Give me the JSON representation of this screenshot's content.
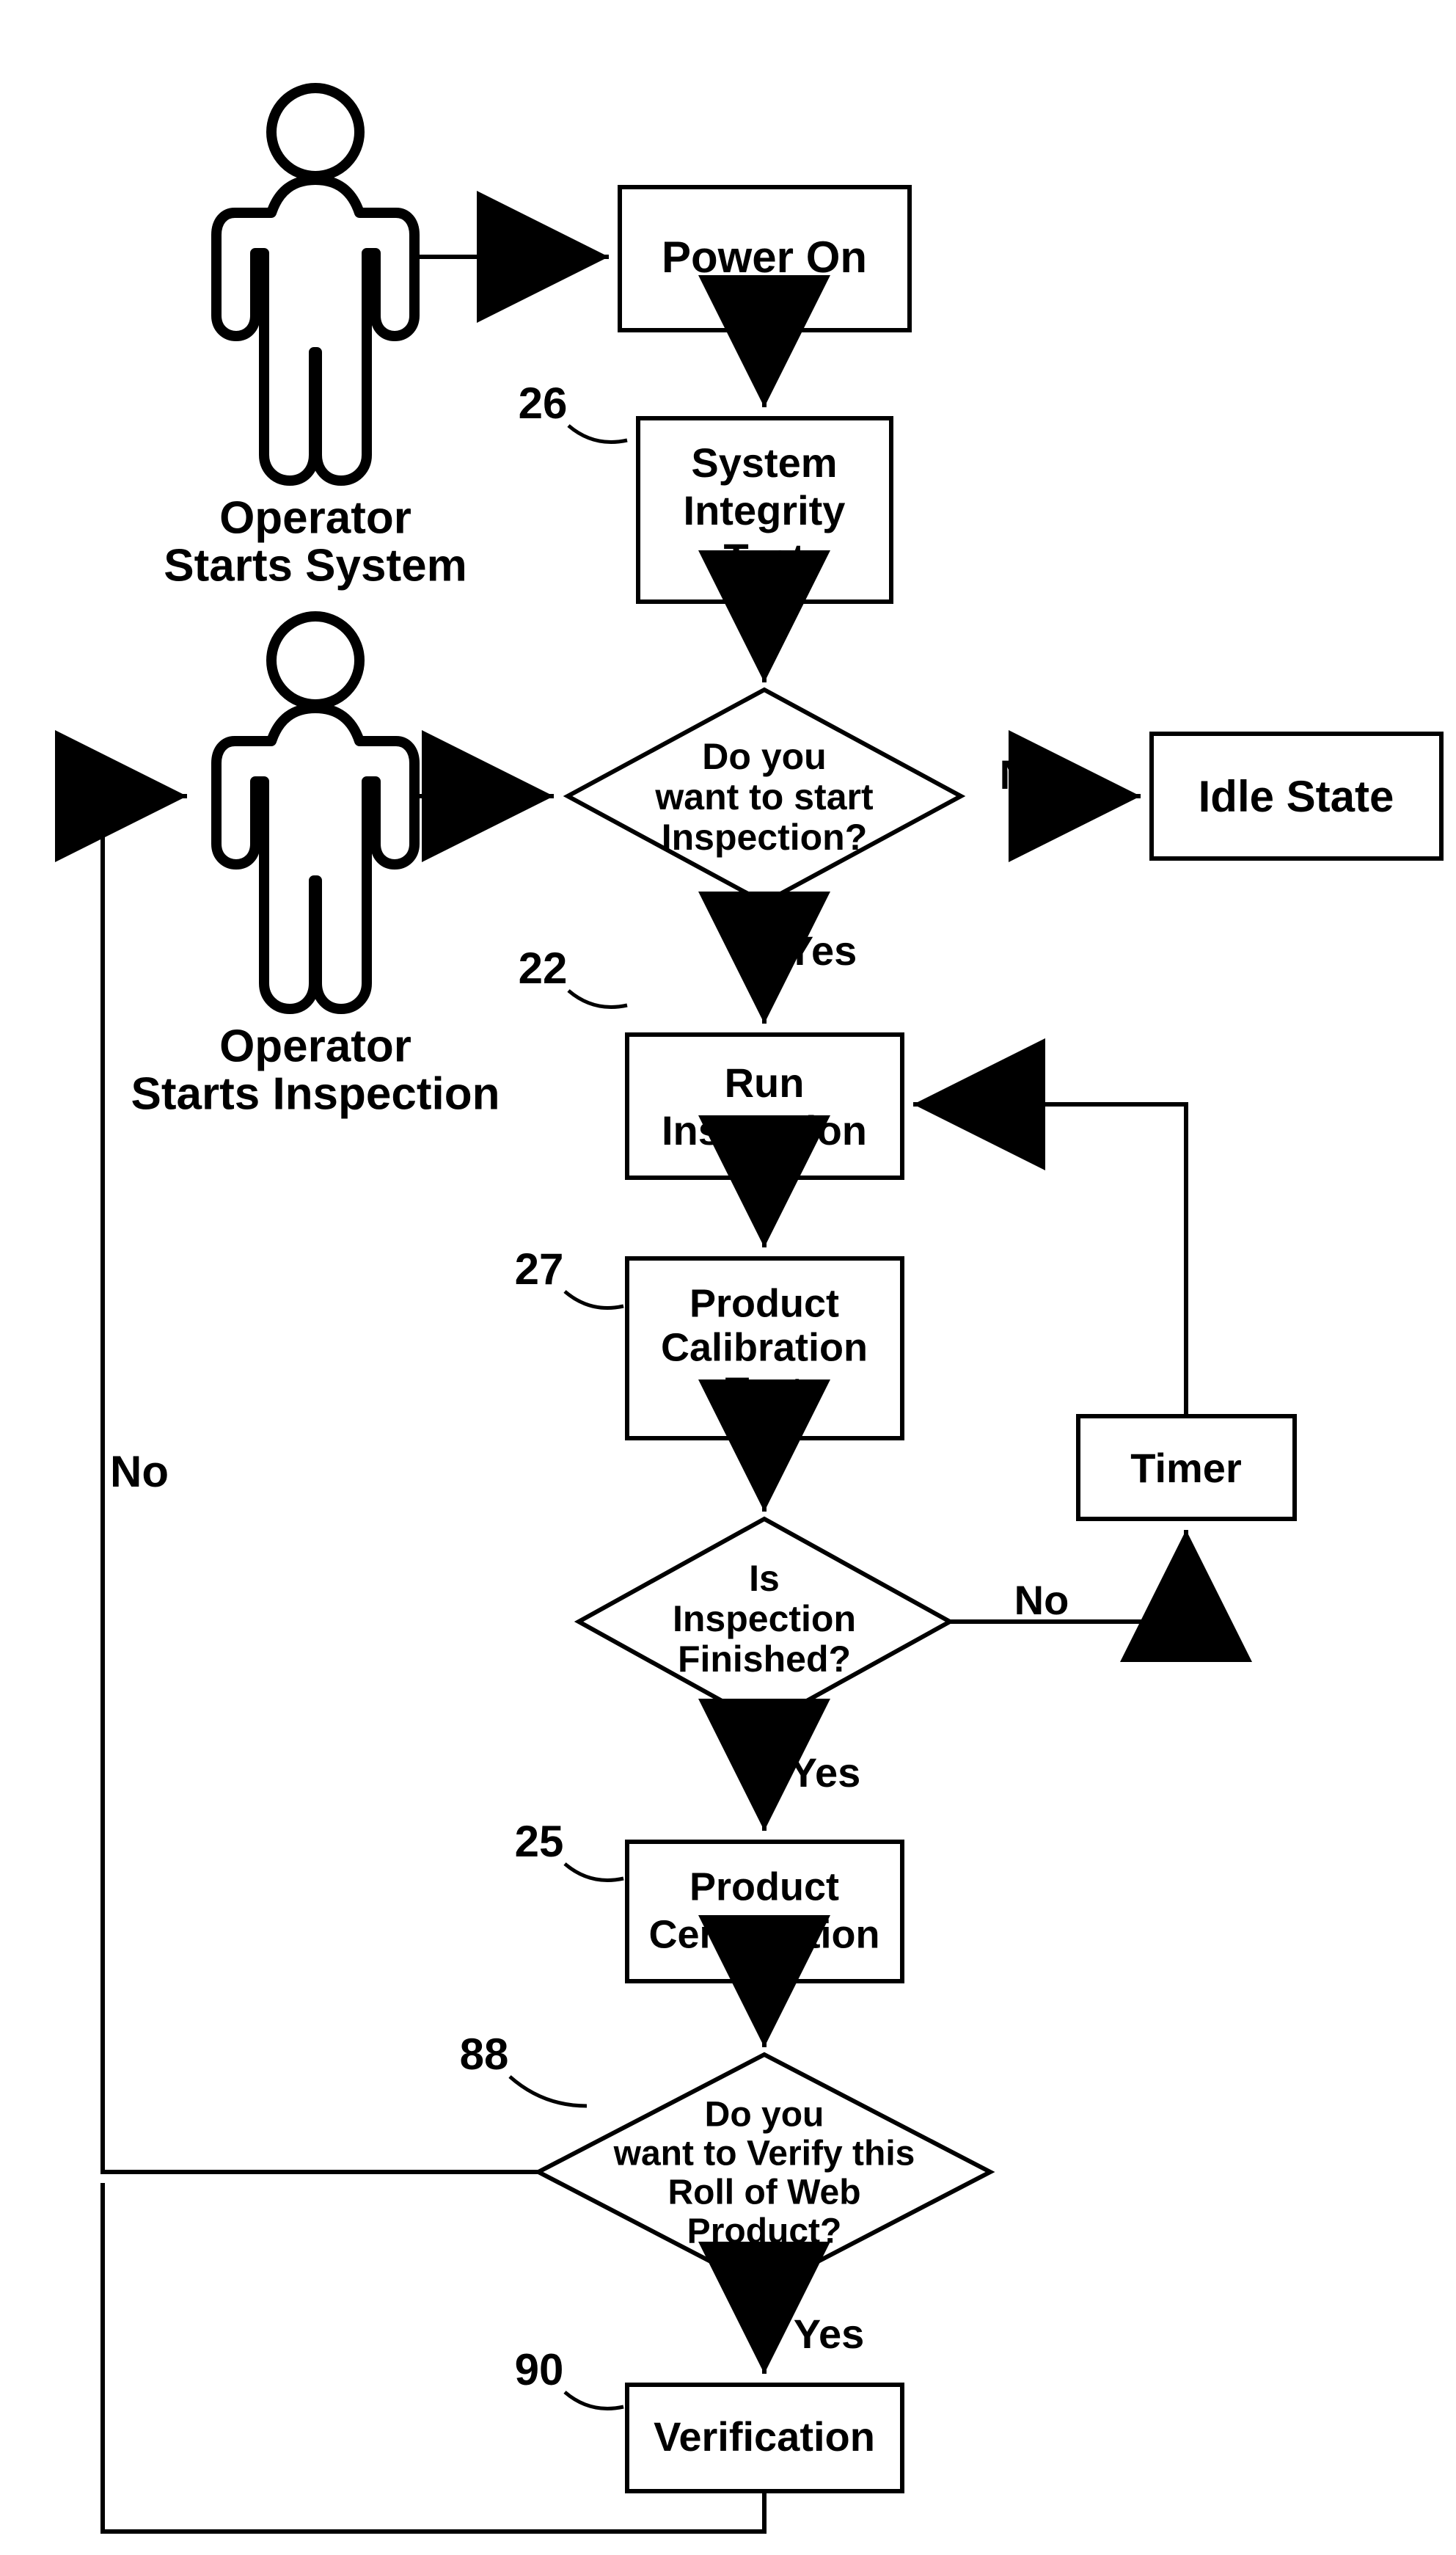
{
  "operator1_line1": "Operator",
  "operator1_line2": "Starts System",
  "operator2_line1": "Operator",
  "operator2_line2": "Starts Inspection",
  "power_on": "Power On",
  "sys_integrity_l1": "System",
  "sys_integrity_l2": "Integrity",
  "sys_integrity_l3": "Test",
  "start_insp_l1": "Do you",
  "start_insp_l2": "want to start",
  "start_insp_l3": "Inspection?",
  "idle_state": "Idle State",
  "run_insp_l1": "Run",
  "run_insp_l2": "Inspection",
  "prod_cal_l1": "Product",
  "prod_cal_l2": "Calibration",
  "prod_cal_l3": "Test",
  "timer": "Timer",
  "insp_fin_l1": "Is",
  "insp_fin_l2": "Inspection",
  "insp_fin_l3": "Finished?",
  "prod_cert_l1": "Product",
  "prod_cert_l2": "Certification",
  "verify_l1": "Do you",
  "verify_l2": "want to Verify this",
  "verify_l3": "Roll of Web",
  "verify_l4": "Product?",
  "verification": "Verification",
  "yes": "Yes",
  "no": "No",
  "ref26": "26",
  "ref22": "22",
  "ref27": "27",
  "ref25": "25",
  "ref88": "88",
  "ref90": "90"
}
